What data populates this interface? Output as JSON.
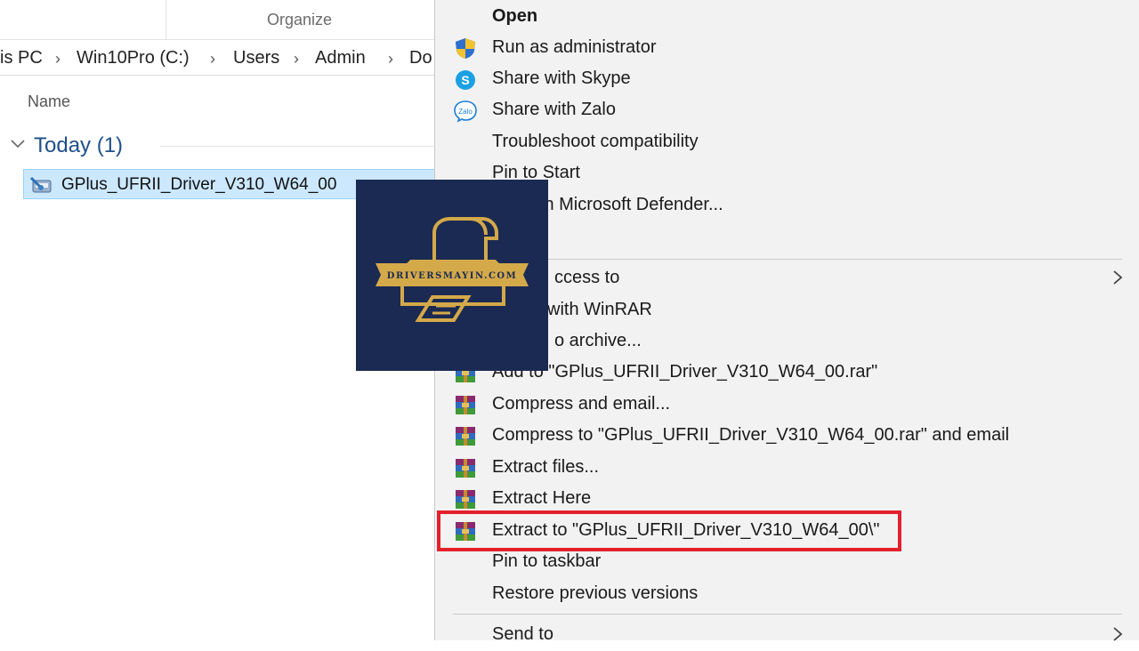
{
  "explorer": {
    "ribbon_label": "Organize",
    "breadcrumb": [
      "is PC",
      "Win10Pro (C:)",
      "Users",
      "Admin",
      "Do"
    ],
    "column_header": "Name",
    "group_label": "Today (1)",
    "file_name": "GPlus_UFRII_Driver_V310_W64_00"
  },
  "menu": {
    "items": [
      {
        "label": "Open",
        "bold": true
      },
      {
        "label": "Run as administrator",
        "icon": "uac-shield-icon"
      },
      {
        "label": "Share with Skype",
        "icon": "skype-icon"
      },
      {
        "label": "Share with Zalo",
        "icon": "zalo-icon"
      },
      {
        "label": "Troubleshoot compatibility"
      },
      {
        "label": "Pin to Start"
      },
      {
        "label": "with Microsoft Defender..."
      },
      {
        "label": ""
      },
      {
        "label": "ccess to",
        "submenu": true
      },
      {
        "label": "with WinRAR"
      },
      {
        "label": "o archive..."
      },
      {
        "label": "Add to \"GPlus_UFRII_Driver_V310_W64_00.rar\"",
        "icon": "winrar-icon"
      },
      {
        "label": "Compress and email...",
        "icon": "winrar-icon"
      },
      {
        "label": "Compress to \"GPlus_UFRII_Driver_V310_W64_00.rar\" and email",
        "icon": "winrar-icon"
      },
      {
        "label": "Extract files...",
        "icon": "winrar-icon"
      },
      {
        "label": "Extract Here",
        "icon": "winrar-icon"
      },
      {
        "label": "Extract to \"GPlus_UFRII_Driver_V310_W64_00\\\"",
        "icon": "winrar-icon",
        "highlighted": true
      },
      {
        "label": "Pin to taskbar"
      },
      {
        "label": "Restore previous versions"
      },
      {
        "label": "Send to",
        "submenu": true
      }
    ]
  },
  "watermark": {
    "text": "DRIVERSMAYIN.COM",
    "bg_color": "#1b2a52",
    "accent_color": "#d4a94a"
  },
  "colors": {
    "highlight_border": "#e4202d",
    "group_label": "#1e4f8e",
    "selection_bg": "#cce8ff"
  }
}
